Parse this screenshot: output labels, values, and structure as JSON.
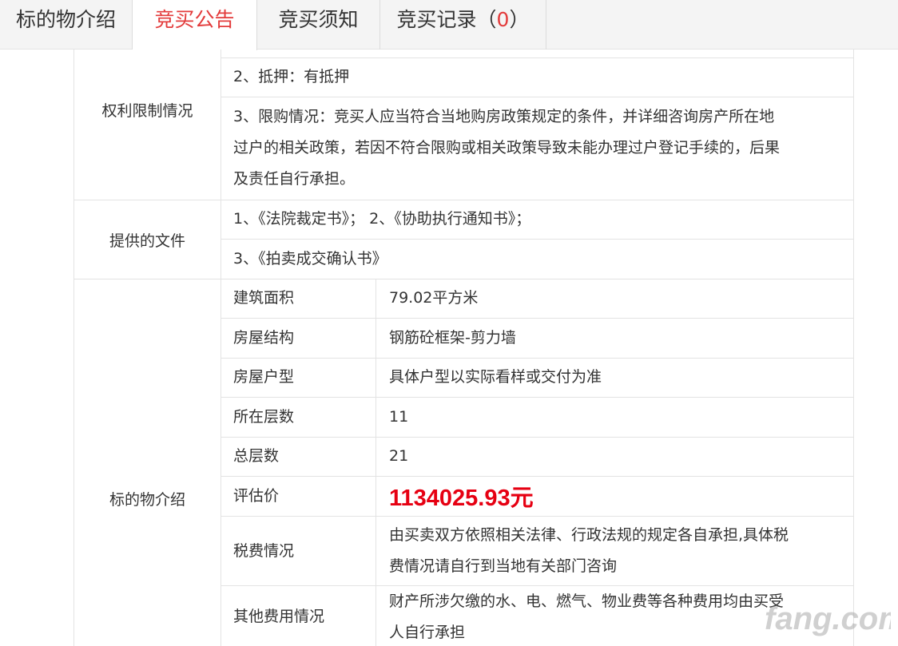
{
  "tabs": [
    {
      "label": "标的物介绍",
      "active": false
    },
    {
      "label": "竞买公告",
      "active": true
    },
    {
      "label": "竞买须知",
      "active": false
    },
    {
      "label": "竞买记录",
      "open": "（",
      "count": "0",
      "close": "）",
      "active": false
    }
  ],
  "rights": {
    "label": "权利限制情况",
    "line2": "2、抵押：有抵押",
    "line3": [
      "3、限购情况：竞买人应当符合当地购房政策规定的条件，并详细咨询房产所在地",
      "过户的相关政策，若因不符合限购或相关政策导致未能办理过户登记手续的，后果",
      "及责任自行承担。"
    ]
  },
  "documents": {
    "label": "提供的文件",
    "line1": "1、《法院裁定书》；  2、《协助执行通知书》；",
    "line2": "3、《拍卖成交确认书》"
  },
  "subject": {
    "label": "标的物介绍",
    "rows": [
      {
        "key": "建筑面积",
        "value": "79.02平方米"
      },
      {
        "key": "房屋结构",
        "value": "钢筋砼框架-剪力墙"
      },
      {
        "key": "房屋户型",
        "value": "具体户型以实际看样或交付为准"
      },
      {
        "key": "所在层数",
        "value": "11"
      },
      {
        "key": "总层数",
        "value": "21"
      },
      {
        "key": "评估价",
        "value": "1134025.93元"
      },
      {
        "key": "税费情况",
        "value": [
          "由买卖双方依照相关法律、行政法规的规定各自承担,具体税",
          "费情况请自行到当地有关部门咨询"
        ]
      },
      {
        "key": "其他费用情况",
        "value": [
          "财产所涉欠缴的水、电、燃气、物业费等各种费用均由买受",
          "人自行承担"
        ]
      }
    ]
  },
  "watermark": "fang.com",
  "colors": {
    "accent": "#e33b3b",
    "price": "#e60012",
    "border": "#e3e3e3"
  }
}
